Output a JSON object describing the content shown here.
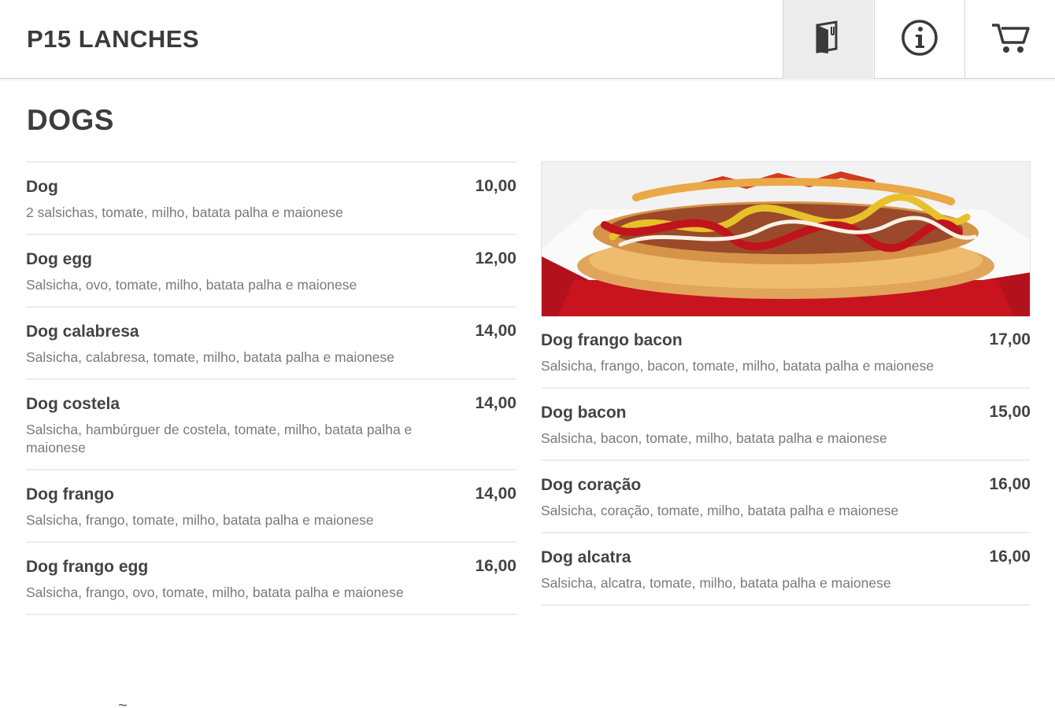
{
  "header": {
    "title": "P15 LANCHES",
    "icons": [
      "menu-book-icon",
      "info-icon",
      "cart-icon"
    ]
  },
  "section": {
    "title": "DOGS"
  },
  "photo_alt": "Hot dog with ketchup, mustard and mayonnaise",
  "left_items": [
    {
      "name": "Dog",
      "price": "10,00",
      "desc": "2 salsichas, tomate, milho, batata palha e maionese"
    },
    {
      "name": "Dog egg",
      "price": "12,00",
      "desc": "Salsicha, ovo, tomate, milho, batata palha e maionese"
    },
    {
      "name": "Dog calabresa",
      "price": "14,00",
      "desc": "Salsicha, calabresa, tomate, milho, batata palha e maionese"
    },
    {
      "name": "Dog costela",
      "price": "14,00",
      "desc": "Salsicha, hambúrguer de costela, tomate, milho, batata palha e maionese"
    },
    {
      "name": "Dog frango",
      "price": "14,00",
      "desc": "Salsicha, frango, tomate, milho, batata palha e maionese"
    },
    {
      "name": "Dog frango egg",
      "price": "16,00",
      "desc": "Salsicha, frango, ovo, tomate, milho, batata palha e maionese"
    }
  ],
  "right_items": [
    {
      "name": "Dog frango bacon",
      "price": "17,00",
      "desc": "Salsicha, frango, bacon, tomate, milho, batata palha e maionese"
    },
    {
      "name": "Dog bacon",
      "price": "15,00",
      "desc": "Salsicha, bacon, tomate, milho, batata palha e maionese"
    },
    {
      "name": "Dog coração",
      "price": "16,00",
      "desc": "Salsicha, coração, tomate, milho, batata palha e maionese"
    },
    {
      "name": "Dog alcatra",
      "price": "16,00",
      "desc": "Salsicha, alcatra, tomate, milho, batata palha e maionese"
    }
  ],
  "footer_partial": "~"
}
